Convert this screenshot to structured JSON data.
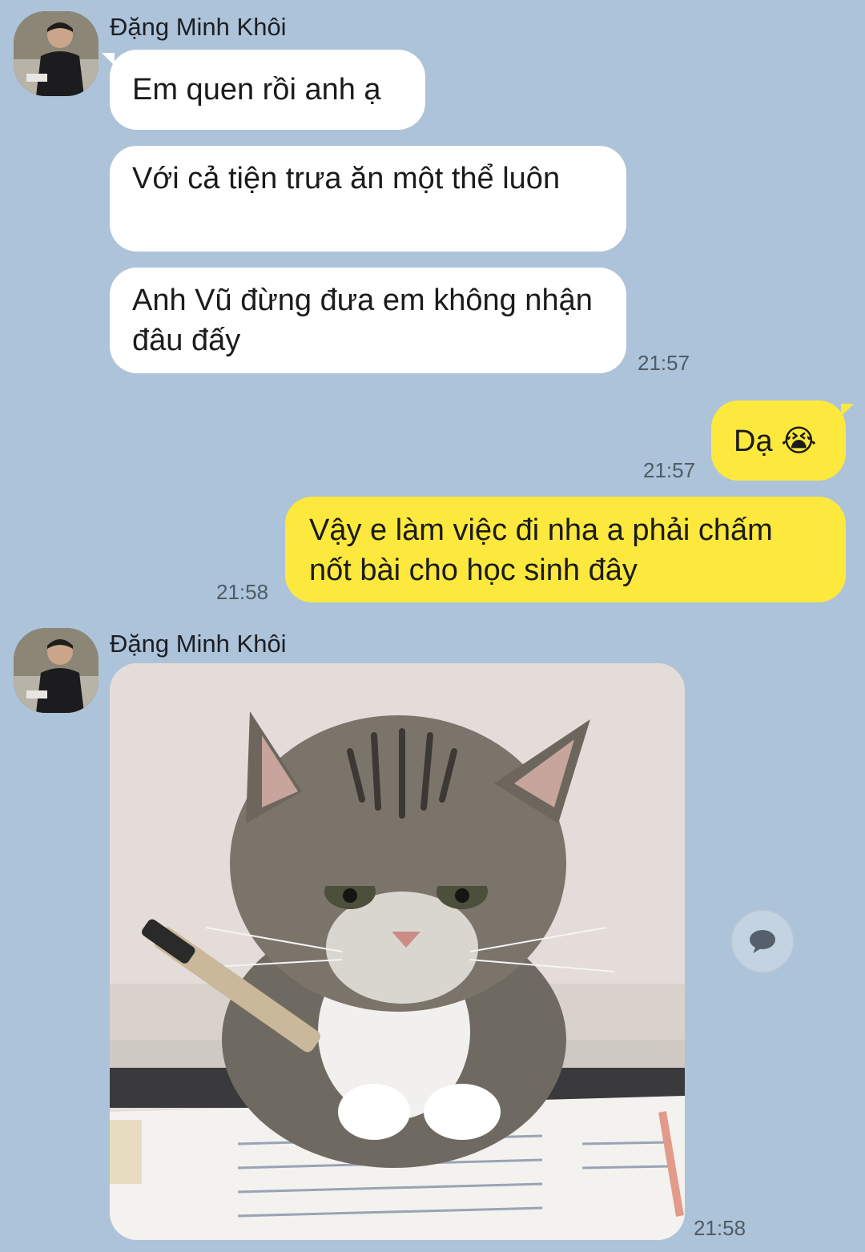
{
  "contact": {
    "name": "Đặng Minh Khôi"
  },
  "messages": [
    {
      "id": "m1",
      "direction": "incoming",
      "text": "Em quen rồi anh ạ"
    },
    {
      "id": "m2",
      "direction": "incoming",
      "text": "Với cả tiện trưa ăn một thể luôn"
    },
    {
      "id": "m3",
      "direction": "incoming",
      "text": "Anh Vũ đừng đưa em không nhận đâu đấy",
      "time": "21:57"
    },
    {
      "id": "m4",
      "direction": "outgoing",
      "text": "Dạ 😭",
      "time": "21:57"
    },
    {
      "id": "m5",
      "direction": "outgoing",
      "text": "Vậy e làm việc đi nha a phải chấm nốt bài cho học sinh đây",
      "time": "21:58"
    },
    {
      "id": "m6",
      "direction": "incoming",
      "type": "image",
      "image_subject": "cat-with-pen-icon",
      "time": "21:58"
    }
  ],
  "icons": {
    "reply": "chat-bubble-icon",
    "avatar": "avatar-icon"
  },
  "colors": {
    "background": "#adc3d9",
    "incoming_bubble": "#ffffff",
    "outgoing_bubble": "#fde83d",
    "timestamp": "#4f5b66"
  }
}
